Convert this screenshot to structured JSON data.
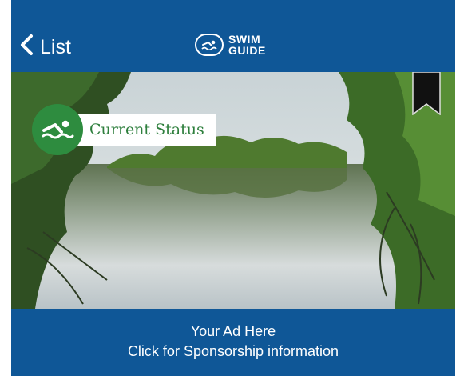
{
  "nav": {
    "back_label": "List",
    "brand_line1": "SWIM",
    "brand_line2": "GUIDE"
  },
  "hero": {
    "status_label": "Current Status",
    "status_color": "#2e8c3f"
  },
  "ad": {
    "line1": "Your Ad Here",
    "line2": "Click for Sponsorship information"
  },
  "colors": {
    "brand_blue": "#0f5797",
    "status_green": "#2e8c3f"
  },
  "icons": {
    "back": "chevron-left-icon",
    "logo": "swimmer-logo-icon",
    "status": "swimmer-icon",
    "bookmark": "bookmark-icon"
  }
}
